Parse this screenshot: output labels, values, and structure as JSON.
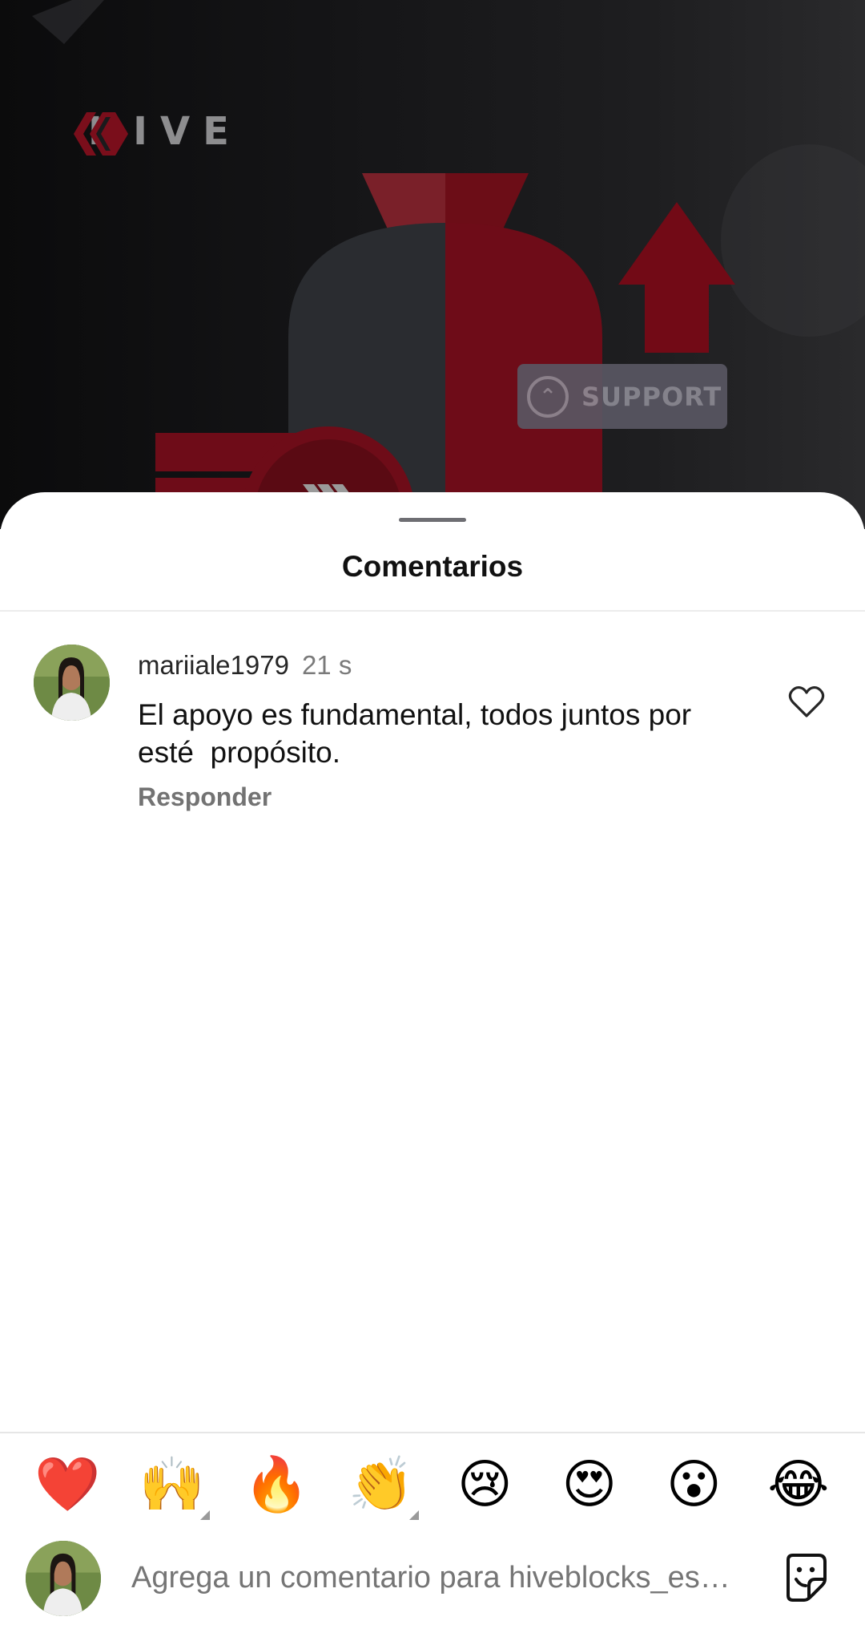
{
  "post": {
    "logo_text": "HIVE",
    "badge_text": "SUPPORT"
  },
  "sheet": {
    "title": "Comentarios"
  },
  "comments": [
    {
      "username": "mariiale1979",
      "time": "21 s",
      "text": "El apoyo es fundamental, todos juntos por\nesté  propósito.",
      "reply_label": "Responder",
      "avatar": "user-photo-avatar",
      "like_icon": "heart-outline-icon"
    }
  ],
  "emoji_bar": [
    {
      "glyph": "❤️",
      "name": "red-heart",
      "has_variants": false
    },
    {
      "glyph": "🙌",
      "name": "raising-hands",
      "has_variants": true
    },
    {
      "glyph": "🔥",
      "name": "fire",
      "has_variants": false
    },
    {
      "glyph": "👏",
      "name": "clapping-hands",
      "has_variants": true
    },
    {
      "glyph": "😢",
      "name": "crying-face",
      "has_variants": false
    },
    {
      "glyph": "😍",
      "name": "heart-eyes",
      "has_variants": false
    },
    {
      "glyph": "😮",
      "name": "surprised-face",
      "has_variants": false
    },
    {
      "glyph": "😂",
      "name": "tears-of-joy",
      "has_variants": false
    }
  ],
  "composer": {
    "placeholder": "Agrega un comentario para hiveblocks_es…",
    "sticker_icon": "sticker-icon"
  },
  "colors": {
    "hive_red": "#7a0e1b",
    "bg_dark": "#141416",
    "text_primary": "#111111",
    "text_secondary": "#737373"
  }
}
